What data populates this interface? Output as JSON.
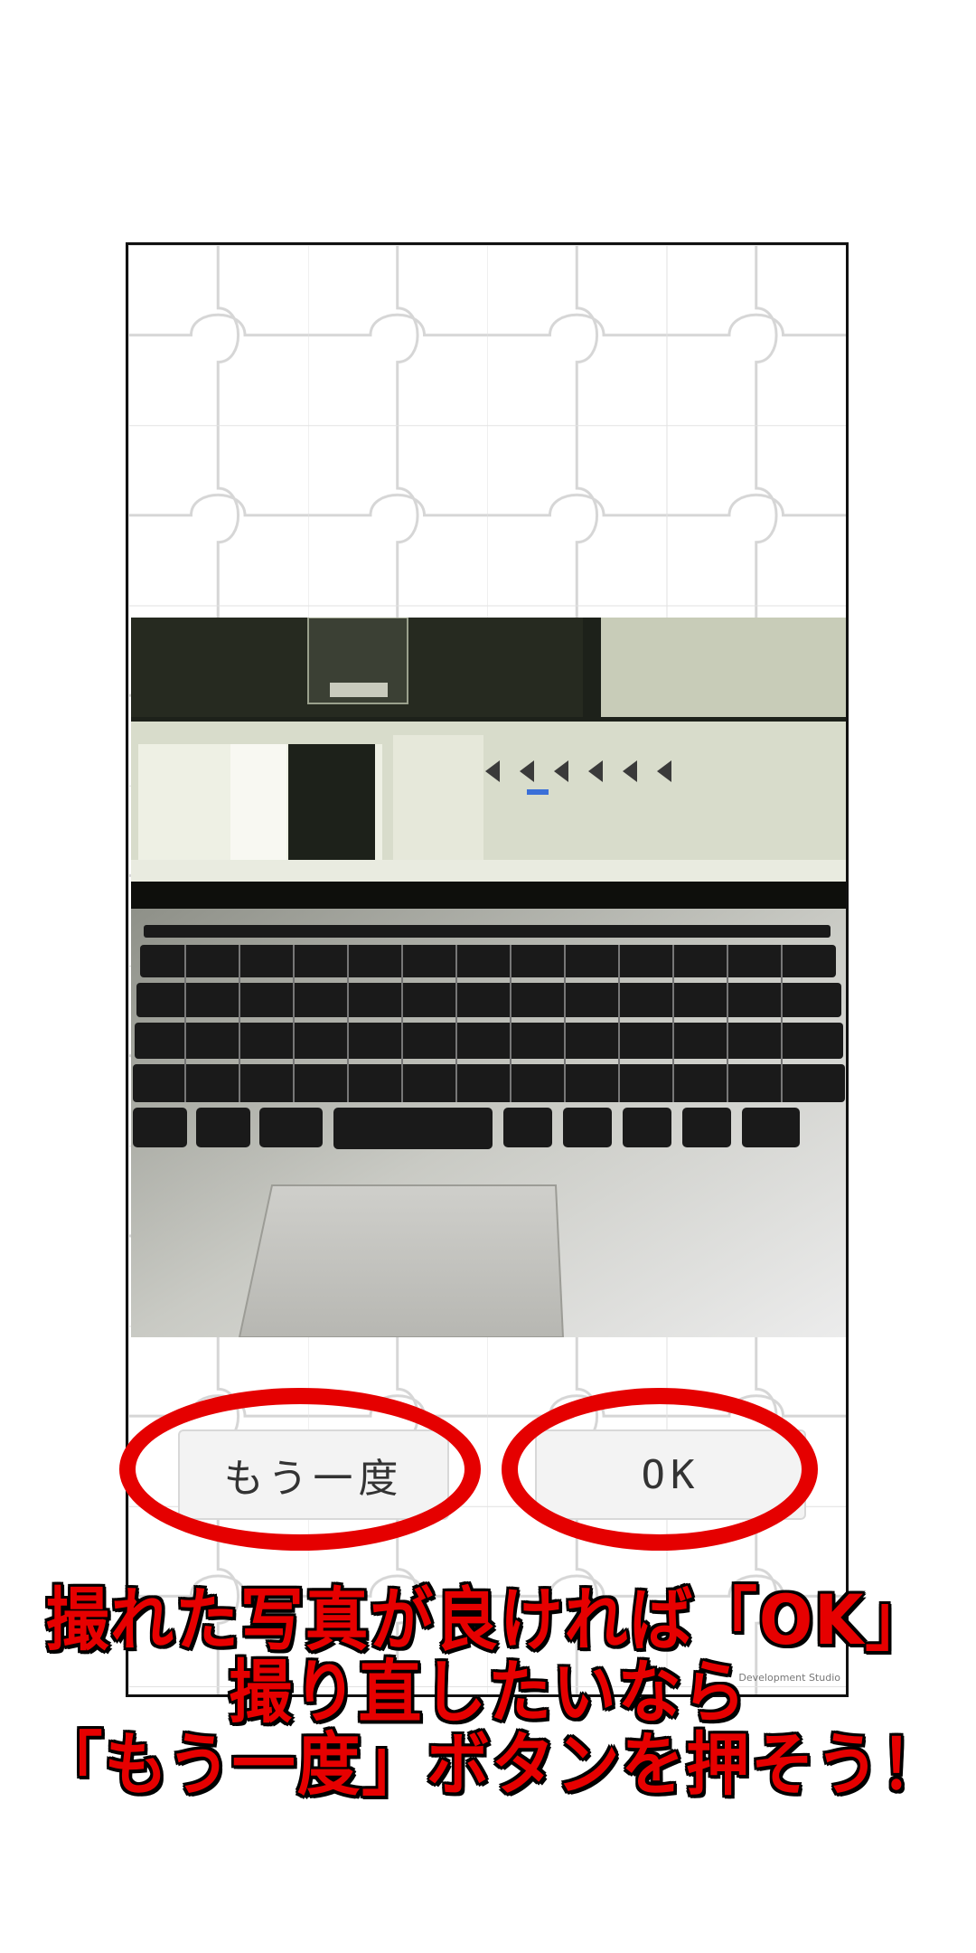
{
  "buttons": {
    "retake_label": "もう一度",
    "ok_label": "OK"
  },
  "watermark": "Development Studio",
  "caption": {
    "line1": "撮れた写真が良ければ「OK」",
    "line2": "撮り直したいなら",
    "line3": "「もう一度」ボタンを押そう！"
  },
  "colors": {
    "highlight": "#e50000",
    "button_bg": "#f3f3f3",
    "puzzle_lines": "#d6d6d6"
  },
  "icons": [
    "unity-logo-icon"
  ]
}
